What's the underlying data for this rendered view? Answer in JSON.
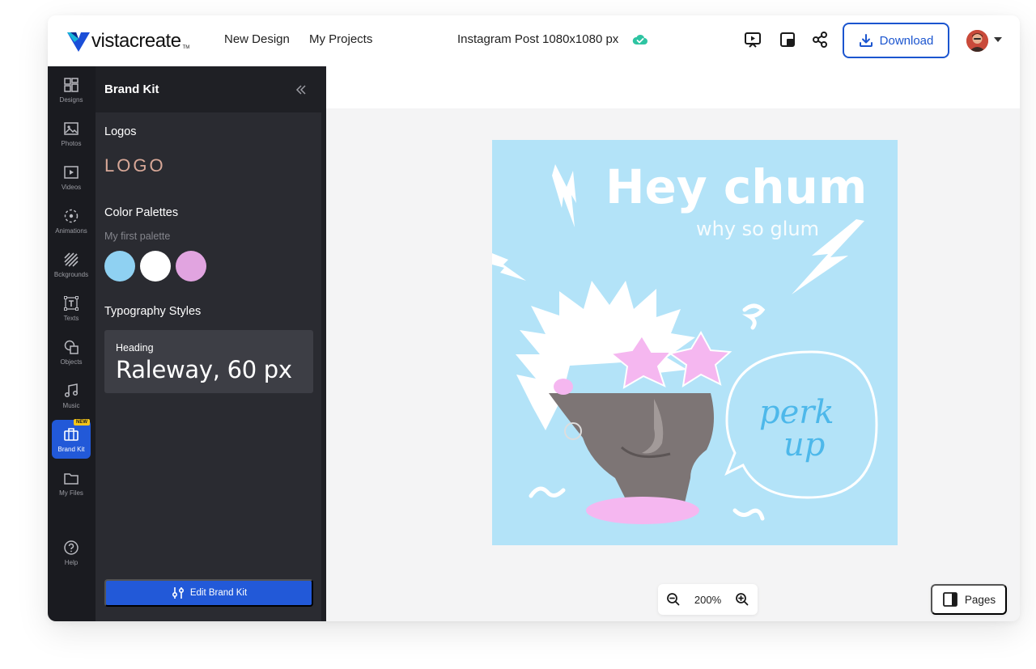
{
  "app": {
    "brand": "vistacreate",
    "brand_tm": "TM",
    "nav": [
      "New Design",
      "My Projects"
    ],
    "doc_title": "Instagram Post 1080x1080 px",
    "download_label": "Download"
  },
  "rail": {
    "items": [
      {
        "label": "Designs",
        "icon": "designs-icon"
      },
      {
        "label": "Photos",
        "icon": "photos-icon"
      },
      {
        "label": "Videos",
        "icon": "videos-icon"
      },
      {
        "label": "Animations",
        "icon": "animations-icon"
      },
      {
        "label": "Bckgrounds",
        "icon": "backgrounds-icon"
      },
      {
        "label": "Texts",
        "icon": "texts-icon"
      },
      {
        "label": "Objects",
        "icon": "objects-icon"
      },
      {
        "label": "Music",
        "icon": "music-icon"
      },
      {
        "label": "Brand Kit",
        "icon": "brand-kit-icon",
        "badge": "NEW"
      },
      {
        "label": "My Files",
        "icon": "folder-icon"
      },
      {
        "label": "Help",
        "icon": "help-icon"
      }
    ]
  },
  "panel": {
    "title": "Brand Kit",
    "logos_title": "Logos",
    "logo_text": "LOGO",
    "palettes_title": "Color Palettes",
    "palette_name": "My first palette",
    "palette_colors": [
      "#8fd1f2",
      "#ffffff",
      "#e1a4e0"
    ],
    "typography_title": "Typography Styles",
    "typography_label": "Heading",
    "typography_value": "Raleway, 60 px",
    "edit_label": "Edit Brand Kit"
  },
  "artboard": {
    "headline": "Hey chum",
    "subhead": "why so glum",
    "bubble_text_1": "perk",
    "bubble_text_2": "up",
    "background": "#b3e3f8"
  },
  "zoom": "200%",
  "pages_label": "Pages"
}
